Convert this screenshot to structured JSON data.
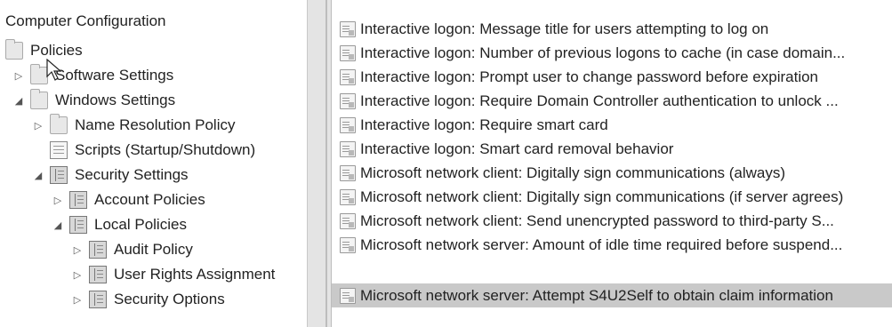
{
  "tree": {
    "title": "Computer Configuration",
    "items": [
      {
        "label": "Policies",
        "icon": "folder-icon"
      },
      {
        "label": "Software Settings",
        "icon": "folder-icon",
        "expander": "▷"
      },
      {
        "label": "Windows Settings",
        "icon": "folder-icon",
        "expander": "◢"
      },
      {
        "label": "Name Resolution Policy",
        "icon": "folder-icon",
        "expander": "▷"
      },
      {
        "label": "Scripts (Startup/Shutdown)",
        "icon": "script-icon"
      },
      {
        "label": "Security Settings",
        "icon": "security-settings-icon",
        "expander": "◢"
      },
      {
        "label": "Account Policies",
        "icon": "policy-book-icon",
        "expander": "▷"
      },
      {
        "label": "Local Policies",
        "icon": "policy-book-icon",
        "expander": "◢"
      },
      {
        "label": "Audit Policy",
        "icon": "policy-book-icon",
        "expander": "▷"
      },
      {
        "label": "User Rights Assignment",
        "icon": "policy-book-icon",
        "expander": "▷"
      },
      {
        "label": "Security Options",
        "icon": "policy-book-icon",
        "expander": "▷"
      }
    ]
  },
  "policies": [
    "Interactive logon: Message title for users attempting to log on",
    "Interactive logon: Number of previous logons to cache (in case domain...",
    "Interactive logon: Prompt user to change password before expiration",
    "Interactive logon: Require Domain Controller authentication to unlock ...",
    "Interactive logon: Require smart card",
    "Interactive logon: Smart card removal behavior",
    "Microsoft network client: Digitally sign communications (always)",
    "Microsoft network client: Digitally sign communications (if server agrees)",
    "Microsoft network client: Send unencrypted password to third-party S...",
    "Microsoft network server: Amount of idle time required before suspend...",
    "Microsoft network server: Attempt S4U2Self to obtain claim information"
  ],
  "selected_policy_index": 10,
  "colors": {
    "selected_row": "#c9c9c9",
    "splitter": "#e4e4e4"
  }
}
